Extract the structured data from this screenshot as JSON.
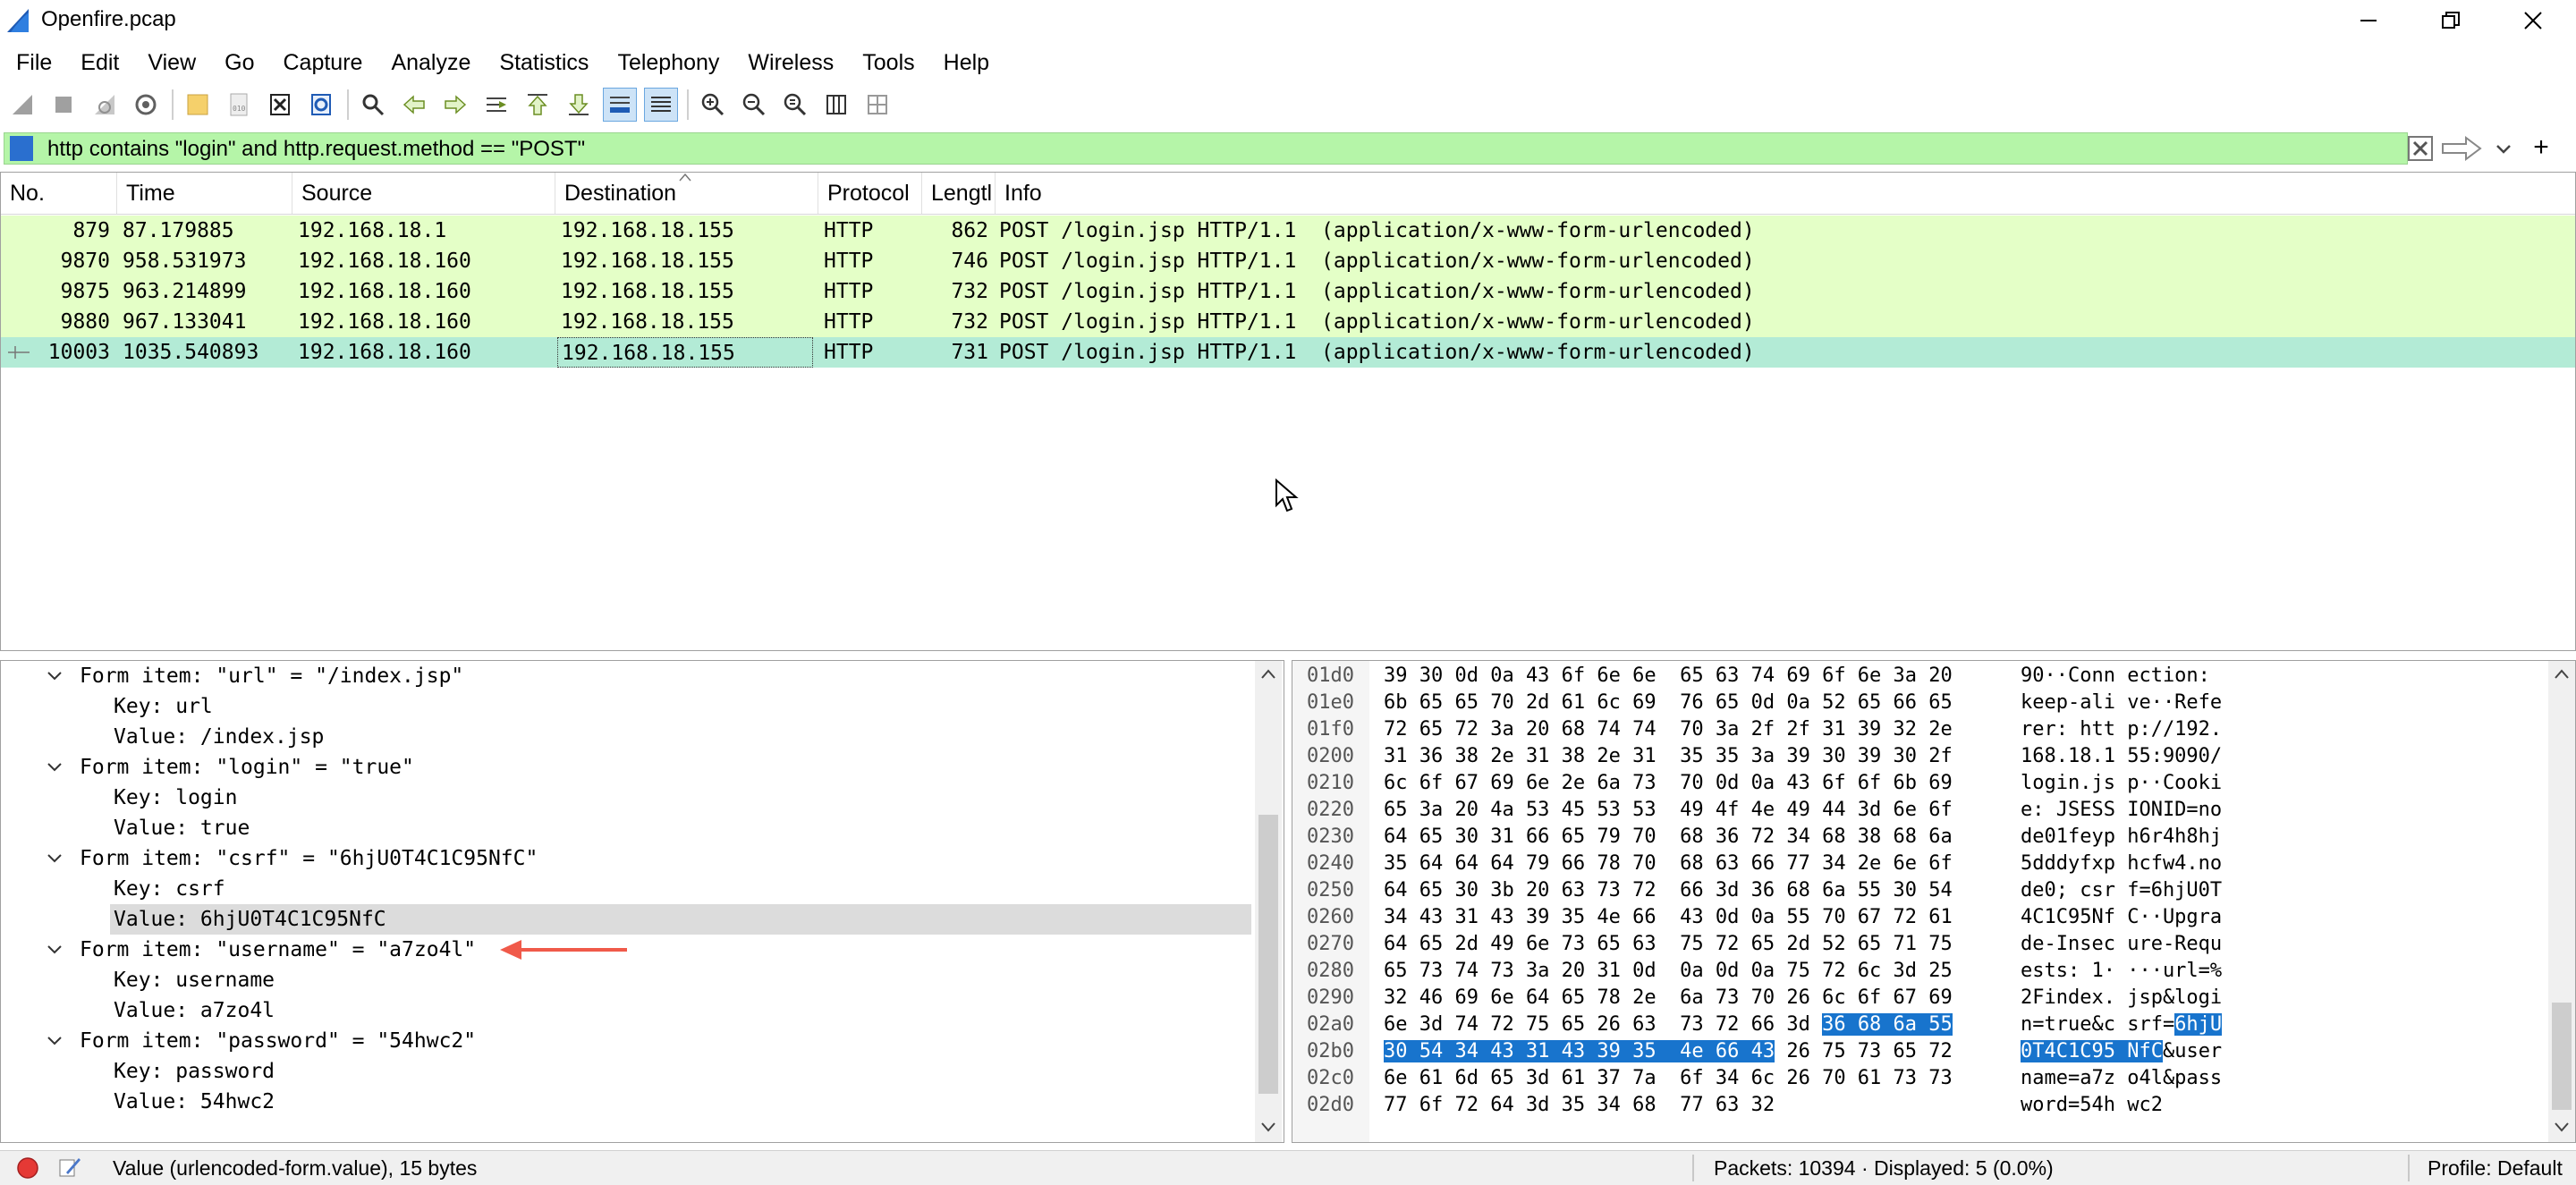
{
  "window": {
    "title": "Openfire.pcap"
  },
  "menu": [
    "File",
    "Edit",
    "View",
    "Go",
    "Capture",
    "Analyze",
    "Statistics",
    "Telephony",
    "Wireless",
    "Tools",
    "Help"
  ],
  "filter": {
    "text": "http contains \"login\" and http.request.method == \"POST\"",
    "add": "+"
  },
  "packet_list": {
    "columns": [
      "No.",
      "Time",
      "Source",
      "Destination",
      "Protocol",
      "Lengtl",
      "Info"
    ],
    "rows": [
      {
        "no": "879",
        "time": "87.179885",
        "src": "192.168.18.1",
        "dst": "192.168.18.155",
        "proto": "HTTP",
        "len": "862",
        "info": "POST /login.jsp HTTP/1.1  (application/x-www-form-urlencoded)"
      },
      {
        "no": "9870",
        "time": "958.531973",
        "src": "192.168.18.160",
        "dst": "192.168.18.155",
        "proto": "HTTP",
        "len": "746",
        "info": "POST /login.jsp HTTP/1.1  (application/x-www-form-urlencoded)"
      },
      {
        "no": "9875",
        "time": "963.214899",
        "src": "192.168.18.160",
        "dst": "192.168.18.155",
        "proto": "HTTP",
        "len": "732",
        "info": "POST /login.jsp HTTP/1.1  (application/x-www-form-urlencoded)"
      },
      {
        "no": "9880",
        "time": "967.133041",
        "src": "192.168.18.160",
        "dst": "192.168.18.155",
        "proto": "HTTP",
        "len": "732",
        "info": "POST /login.jsp HTTP/1.1  (application/x-www-form-urlencoded)"
      },
      {
        "no": "10003",
        "time": "1035.540893",
        "src": "192.168.18.160",
        "dst": "192.168.18.155",
        "proto": "HTTP",
        "len": "731",
        "info": "POST /login.jsp HTTP/1.1  (application/x-www-form-urlencoded)"
      }
    ]
  },
  "details": [
    {
      "text": "Form item: \"url\" = \"/index.jsp\"",
      "level": 1
    },
    {
      "text": "Key: url",
      "level": 2
    },
    {
      "text": "Value: /index.jsp",
      "level": 2
    },
    {
      "text": "Form item: \"login\" = \"true\"",
      "level": 1
    },
    {
      "text": "Key: login",
      "level": 2
    },
    {
      "text": "Value: true",
      "level": 2
    },
    {
      "text": "Form item: \"csrf\" = \"6hjU0T4C1C95NfC\"",
      "level": 1
    },
    {
      "text": "Key: csrf",
      "level": 2
    },
    {
      "text": "Value: 6hjU0T4C1C95NfC",
      "level": 2
    },
    {
      "text": "Form item: \"username\" = \"a7zo4l\"",
      "level": 1
    },
    {
      "text": "Key: username",
      "level": 2
    },
    {
      "text": "Value: a7zo4l",
      "level": 2
    },
    {
      "text": "Form item: \"password\" = \"54hwc2\"",
      "level": 1
    },
    {
      "text": "Key: password",
      "level": 2
    },
    {
      "text": "Value: 54hwc2",
      "level": 2
    }
  ],
  "bytes": [
    {
      "off": "01d0",
      "hex": "39 30 0d 0a 43 6f 6e 6e  65 63 74 69 6f 6e 3a 20",
      "asc": "90··Conn ection: "
    },
    {
      "off": "01e0",
      "hex": "6b 65 65 70 2d 61 6c 69  76 65 0d 0a 52 65 66 65",
      "asc": "keep-ali ve··Refe"
    },
    {
      "off": "01f0",
      "hex": "72 65 72 3a 20 68 74 74  70 3a 2f 2f 31 39 32 2e",
      "asc": "rer: htt p://192."
    },
    {
      "off": "0200",
      "hex": "31 36 38 2e 31 38 2e 31  35 35 3a 39 30 39 30 2f",
      "asc": "168.18.1 55:9090/"
    },
    {
      "off": "0210",
      "hex": "6c 6f 67 69 6e 2e 6a 73  70 0d 0a 43 6f 6f 6b 69",
      "asc": "login.js p··Cooki"
    },
    {
      "off": "0220",
      "hex": "65 3a 20 4a 53 45 53 53  49 4f 4e 49 44 3d 6e 6f",
      "asc": "e: JSESS IONID=no"
    },
    {
      "off": "0230",
      "hex": "64 65 30 31 66 65 79 70  68 36 72 34 68 38 68 6a",
      "asc": "de01feyp h6r4h8hj"
    },
    {
      "off": "0240",
      "hex": "35 64 64 64 79 66 78 70  68 63 66 77 34 2e 6e 6f",
      "asc": "5dddyfxp hcfw4.no"
    },
    {
      "off": "0250",
      "hex": "64 65 30 3b 20 63 73 72  66 3d 36 68 6a 55 30 54",
      "asc": "de0; csr f=6hjU0T"
    },
    {
      "off": "0260",
      "hex": "34 43 31 43 39 35 4e 66  43 0d 0a 55 70 67 72 61",
      "asc": "4C1C95Nf C··Upgra"
    },
    {
      "off": "0270",
      "hex": "64 65 2d 49 6e 73 65 63  75 72 65 2d 52 65 71 75",
      "asc": "de-Insec ure-Requ"
    },
    {
      "off": "0280",
      "hex": "65 73 74 73 3a 20 31 0d  0a 0d 0a 75 72 6c 3d 25",
      "asc": "ests: 1· ···url=%"
    },
    {
      "off": "0290",
      "hex": "32 46 69 6e 64 65 78 2e  6a 73 70 26 6c 6f 67 69",
      "asc": "2Findex. jsp&logi"
    },
    {
      "off": "02a0",
      "hex": "6e 3d 74 72 75 65 26 63  73 72 66 3d ",
      "hexsel": "36 68 6a 55",
      "asc": "n=true&c srf=",
      "ascsel": "6hjU"
    },
    {
      "off": "02b0",
      "hexsel": "30 54 34 43 31 43 39 35  4e 66 43",
      "hex": " 26 75 73 65 72",
      "ascsel": "0T4C1C95 NfC",
      "asc": "&user"
    },
    {
      "off": "02c0",
      "hex": "6e 61 6d 65 3d 61 37 7a  6f 34 6c 26 70 61 73 73",
      "asc": "name=a7z o4l&pass"
    },
    {
      "off": "02d0",
      "hex": "77 6f 72 64 3d 35 34 68  77 63 32",
      "asc": "word=54h wc2"
    }
  ],
  "status": {
    "field_info": "Value (urlencoded-form.value), 15 bytes",
    "packets": "Packets: 10394 · Displayed: 5 (0.0%)",
    "profile": "Profile: Default"
  },
  "colors": {
    "filter_bg": "#b5f5a8",
    "row_bg": "#e4ffc7",
    "row_selected": "#b3ebd6",
    "byte_highlight": "#1874cd",
    "annotation_arrow": "#f05a4a"
  }
}
